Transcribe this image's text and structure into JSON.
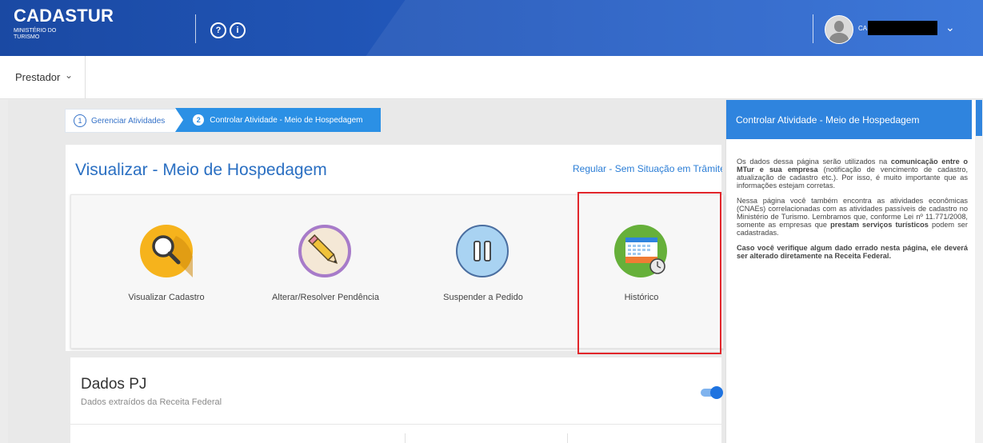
{
  "header": {
    "brand": "CADASTUR",
    "brand_sub": "MINISTÉRIO DO TURISMO",
    "help_glyph": "?",
    "info_glyph": "i",
    "user_short": "CA",
    "icons": [
      "help-circle-icon",
      "info-circle-icon",
      "user-avatar-icon",
      "chevron-down-icon"
    ]
  },
  "subnav": {
    "role": "Prestador",
    "chevron": "⌄"
  },
  "breadcrumb": [
    {
      "num": "1",
      "label": "Gerenciar Atividades"
    },
    {
      "num": "2",
      "label": "Controlar Atividade - Meio de Hospedagem"
    }
  ],
  "page": {
    "title": "Visualizar - Meio de Hospedagem",
    "status": "Regular - Sem Situação em Trâmite"
  },
  "actions": [
    {
      "label": "Visualizar Cadastro",
      "icon": "magnifier-icon",
      "color": "#f6b31c"
    },
    {
      "label": "Alterar/Resolver Pendência",
      "icon": "pencil-icon",
      "color": "#a77bc9"
    },
    {
      "label": "Suspender a Pedido",
      "icon": "pause-icon",
      "color": "#a9d3f2"
    },
    {
      "label": "Histórico",
      "icon": "calendar-clock-icon",
      "color": "#66b03a"
    }
  ],
  "dados_pj": {
    "title": "Dados PJ",
    "subtitle": "Dados extraídos da Receita Federal"
  },
  "help_panel": {
    "title": "Controlar Atividade - Meio de Hospedagem",
    "p1_a": "Os dados dessa página serão utilizados na ",
    "p1_b": "comunicação entre o MTur e sua empresa",
    "p1_c": " (notificação de vencimento de cadastro, atualização de cadastro etc.). Por isso, é muito importante que as informações estejam corretas.",
    "p2_a": "Nessa página você também encontra as atividades econômicas (CNAEs) correlacionadas com as atividades passíveis de cadastro no Ministério de Turismo. Lembramos que, conforme Lei nº 11.771/2008, somente as empresas que ",
    "p2_b": "prestam serviços turísticos",
    "p2_c": " podem ser cadastradas.",
    "p3": "Caso você verifique algum dado errado nesta página, ele deverá ser alterado diretamente na Receita Federal."
  },
  "colors": {
    "primary": "#2f84de",
    "header": "#1a49a3",
    "highlight": "#e1262b"
  }
}
